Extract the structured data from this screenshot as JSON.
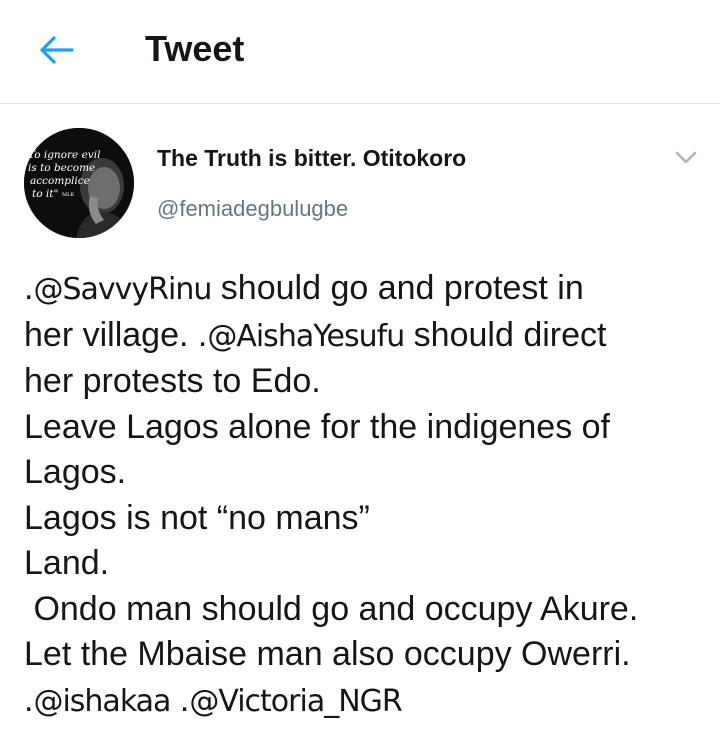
{
  "header": {
    "title": "Tweet",
    "back_icon": "arrow-left-icon",
    "accent_color": "#1da1f2"
  },
  "tweet": {
    "avatar": {
      "quote_lines": [
        "To ignore evil",
        "is to become",
        "accomplice",
        "to it\""
      ],
      "attribution": "MLK"
    },
    "author": {
      "display_name": "The Truth is bitter. Otitokoro",
      "handle": "@femiadegbulugbe"
    },
    "menu_icon": "chevron-down-icon",
    "lines": [
      [
        {
          "t": "."
        },
        {
          "m": "@SavvyRinu"
        },
        {
          "t": " should go and protest in"
        }
      ],
      [
        {
          "t": "her village. ."
        },
        {
          "m": "@AishaYesufu"
        },
        {
          "t": " should direct"
        }
      ],
      [
        {
          "t": "her protests to Edo."
        }
      ],
      [
        {
          "t": "Leave Lagos alone for the indigenes of"
        }
      ],
      [
        {
          "t": "Lagos."
        }
      ],
      [
        {
          "t": "Lagos is not “no mans”"
        }
      ],
      [
        {
          "t": "Land."
        }
      ],
      [
        {
          "t": " Ondo man should go and occupy Akure."
        }
      ],
      [
        {
          "t": "Let the Mbaise man also occupy Owerri."
        }
      ],
      [
        {
          "t": "."
        },
        {
          "m": "@ishakaa"
        },
        {
          "t": " ."
        },
        {
          "m": "@Victoria_NGR"
        }
      ]
    ]
  }
}
